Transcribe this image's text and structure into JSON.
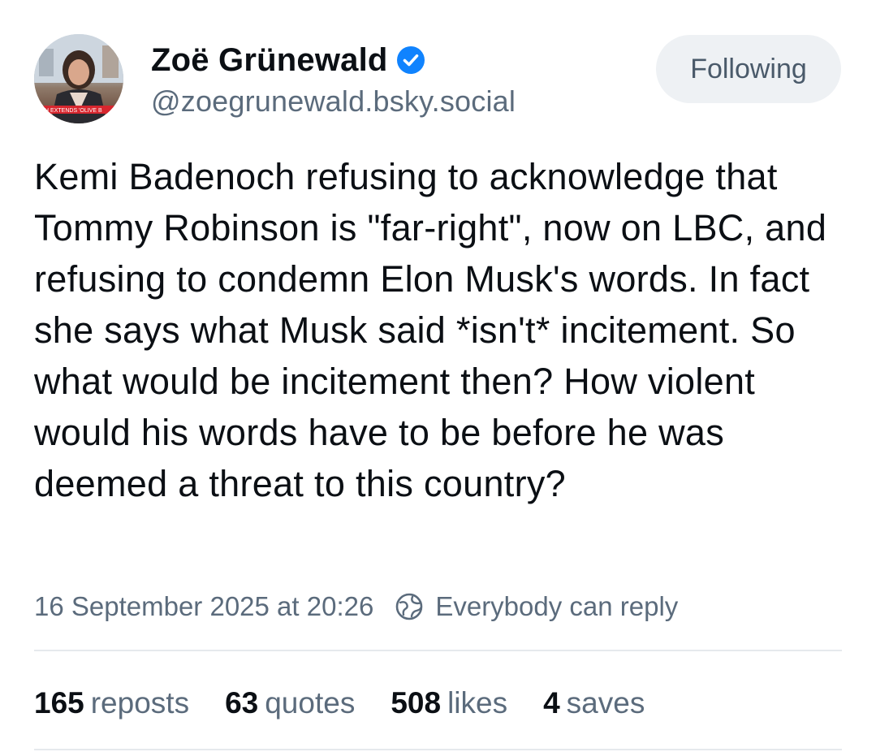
{
  "author": {
    "name": "Zoë Grünewald",
    "handle": "@zoegrunewald.bsky.social",
    "avatar_caption": "CH EXTENDS 'OLIVE B"
  },
  "follow_button": {
    "label": "Following"
  },
  "post": {
    "text": "Kemi Badenoch refusing to acknowledge that Tommy Robinson is \"far-right\", now on LBC, and refusing to condemn Elon Musk's words. In fact she says what Musk said *isn't* incitement. So what would be incitement then? How violent would his words have to be before he was deemed a threat to this country?"
  },
  "meta": {
    "timestamp": "16 September 2025 at 20:26",
    "reply_setting": "Everybody can reply"
  },
  "stats": [
    {
      "count": "165",
      "label": "reposts"
    },
    {
      "count": "63",
      "label": "quotes"
    },
    {
      "count": "508",
      "label": "likes"
    },
    {
      "count": "4",
      "label": "saves"
    }
  ],
  "colors": {
    "verified_badge": "#1083fe",
    "text_primary": "#0b0f14",
    "text_secondary": "#5b6b7c",
    "button_bg": "#eef1f4"
  },
  "icons": {
    "verified": "verified-badge-icon",
    "reply_setting": "globe-icon"
  }
}
